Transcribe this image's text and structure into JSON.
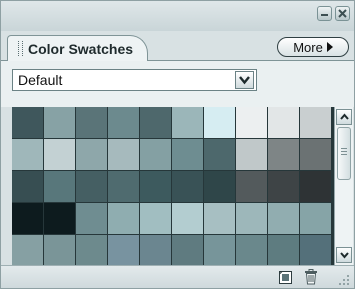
{
  "panel": {
    "tab_label": "Color Swatches",
    "more_label": "More",
    "preset_value": "Default"
  },
  "icons": [
    "minimize-icon",
    "close-icon",
    "more-arrow-icon",
    "chevron-down-icon",
    "scroll-up-icon",
    "scroll-down-icon",
    "new-swatch-icon",
    "trash-icon",
    "resize-grip-icon"
  ],
  "swatches": {
    "columns": 10,
    "rows": [
      [
        "#3f575c",
        "#87a2a5",
        "#5a7478",
        "#6c8a8e",
        "#4e686c",
        "#9bb6b9",
        "#d6edf2",
        "#eceff0",
        "#e2e6e7",
        "#c9cfd0"
      ],
      [
        "#9fb7ba",
        "#c3d1d3",
        "#8ea7aa",
        "#a6babd",
        "#84a0a3",
        "#6e8d91",
        "#4d686c",
        "#c0c8c9",
        "#7e8586",
        "#6b7273"
      ],
      [
        "#374e52",
        "#58777b",
        "#455f63",
        "#4f6b6f",
        "#3d5a5e",
        "#395256",
        "#2f4649",
        "#535a5c",
        "#3e4446",
        "#2e3335"
      ],
      [
        "#0d1b1e",
        "#0d1b1e",
        "#6f8d91",
        "#8fadb0",
        "#a1bec1",
        "#b3cdd0",
        "#a7bfc2",
        "#9db7ba",
        "#91adb0",
        "#86a4a7"
      ],
      [
        "#86a0a3",
        "#7a9598",
        "#6d8a8d",
        "#7893a0",
        "#6b8690",
        "#5f7b80",
        "#77959a",
        "#6a888c",
        "#5e7c80",
        "#54707a"
      ]
    ]
  }
}
